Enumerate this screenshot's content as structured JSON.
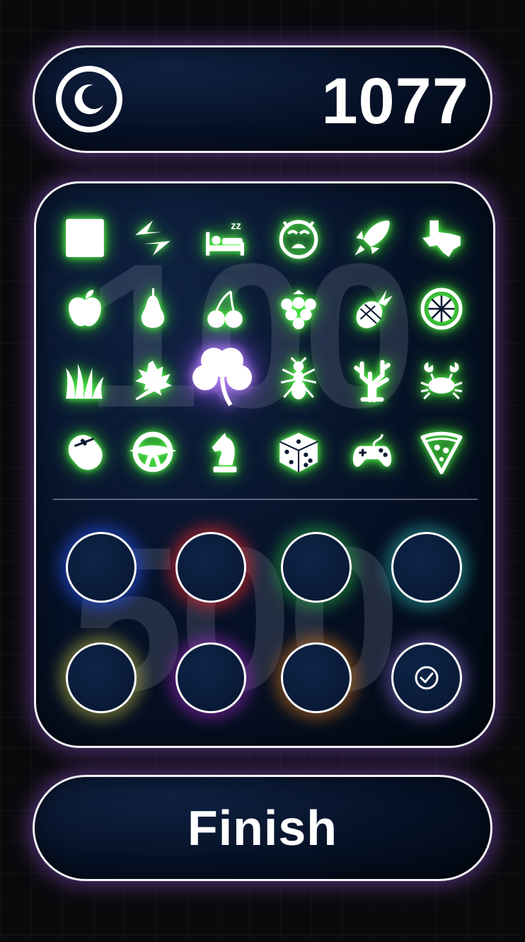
{
  "header": {
    "score": "1077",
    "theme_icon": "moon-icon"
  },
  "board": {
    "background_numbers": [
      "100",
      "500"
    ],
    "icon_color": "#5cff4a",
    "selected_color": "#c58bff",
    "icons": [
      [
        "square-icon",
        "arrows-rotate-icon",
        "sleep-bed-icon",
        "crying-face-icon",
        "rocket-icon",
        "texas-icon"
      ],
      [
        "apple-icon",
        "pear-icon",
        "cherries-icon",
        "raspberry-icon",
        "pineapple-icon",
        "lemon-slice-icon"
      ],
      [
        "grass-icon",
        "maple-leaf-icon",
        "clover-icon",
        "ant-icon",
        "coral-icon",
        "crab-icon"
      ],
      [
        "computer-mouse-icon",
        "steering-wheel-icon",
        "chess-knight-icon",
        "dice-icon",
        "gamepad-icon",
        "pizza-slice-icon"
      ]
    ],
    "selected_icon": "clover-icon",
    "slots": [
      {
        "glow": "#2a55ff",
        "checked": false
      },
      {
        "glow": "#ff2a2a",
        "checked": false
      },
      {
        "glow": "#2cd24a",
        "checked": false
      },
      {
        "glow": "#34d6cf",
        "checked": false
      },
      {
        "glow": "#e6e24a",
        "checked": false
      },
      {
        "glow": "#b02ad6",
        "checked": false
      },
      {
        "glow": "#ff8a1a",
        "checked": false
      },
      {
        "glow": "#8a6bd6",
        "checked": true
      }
    ]
  },
  "finish": {
    "label": "Finish"
  }
}
